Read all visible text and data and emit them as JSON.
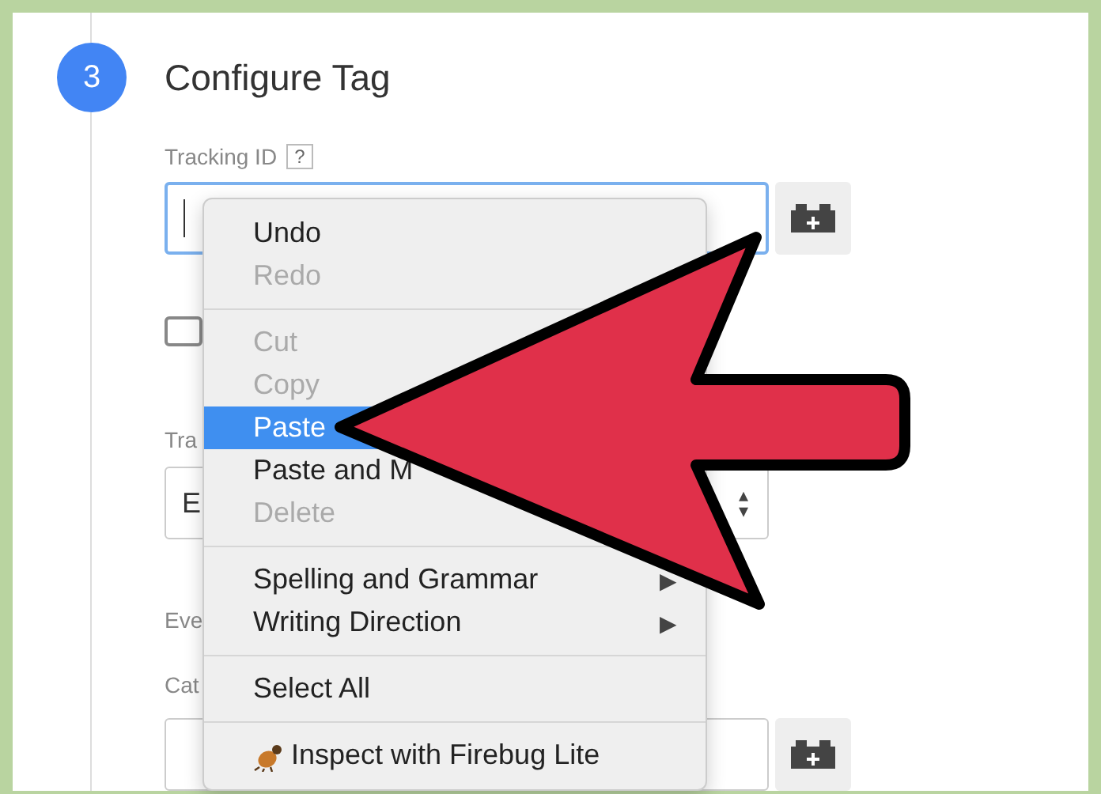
{
  "step": {
    "number": "3",
    "title": "Configure Tag"
  },
  "tracking_id": {
    "label": "Tracking ID",
    "help": "?",
    "focused": true
  },
  "checkbox": {
    "checked": false
  },
  "labels": [
    "Tra",
    "Eve",
    "Cat"
  ],
  "select": {
    "value": "E",
    "arrows": "▴▾"
  },
  "context_menu": [
    {
      "kind": "item",
      "label": "Undo",
      "disabled": false,
      "selected": false
    },
    {
      "kind": "item",
      "label": "Redo",
      "disabled": true,
      "selected": false
    },
    {
      "kind": "separator"
    },
    {
      "kind": "item",
      "label": "Cut",
      "disabled": true,
      "selected": false
    },
    {
      "kind": "item",
      "label": "Copy",
      "disabled": true,
      "selected": false
    },
    {
      "kind": "item",
      "label": "Paste",
      "disabled": false,
      "selected": true
    },
    {
      "kind": "item",
      "label": "Paste and M",
      "disabled": false,
      "selected": false
    },
    {
      "kind": "item",
      "label": "Delete",
      "disabled": true,
      "selected": false
    },
    {
      "kind": "separator"
    },
    {
      "kind": "item",
      "label": "Spelling and Grammar",
      "disabled": false,
      "selected": false,
      "submenu": "▶"
    },
    {
      "kind": "item",
      "label": "Writing Direction",
      "disabled": false,
      "selected": false,
      "submenu": "▶"
    },
    {
      "kind": "separator"
    },
    {
      "kind": "item",
      "label": "Select All",
      "disabled": false,
      "selected": false
    },
    {
      "kind": "separator"
    },
    {
      "kind": "item",
      "label": "Inspect with Firebug Lite",
      "disabled": false,
      "selected": false,
      "icon": true
    }
  ]
}
